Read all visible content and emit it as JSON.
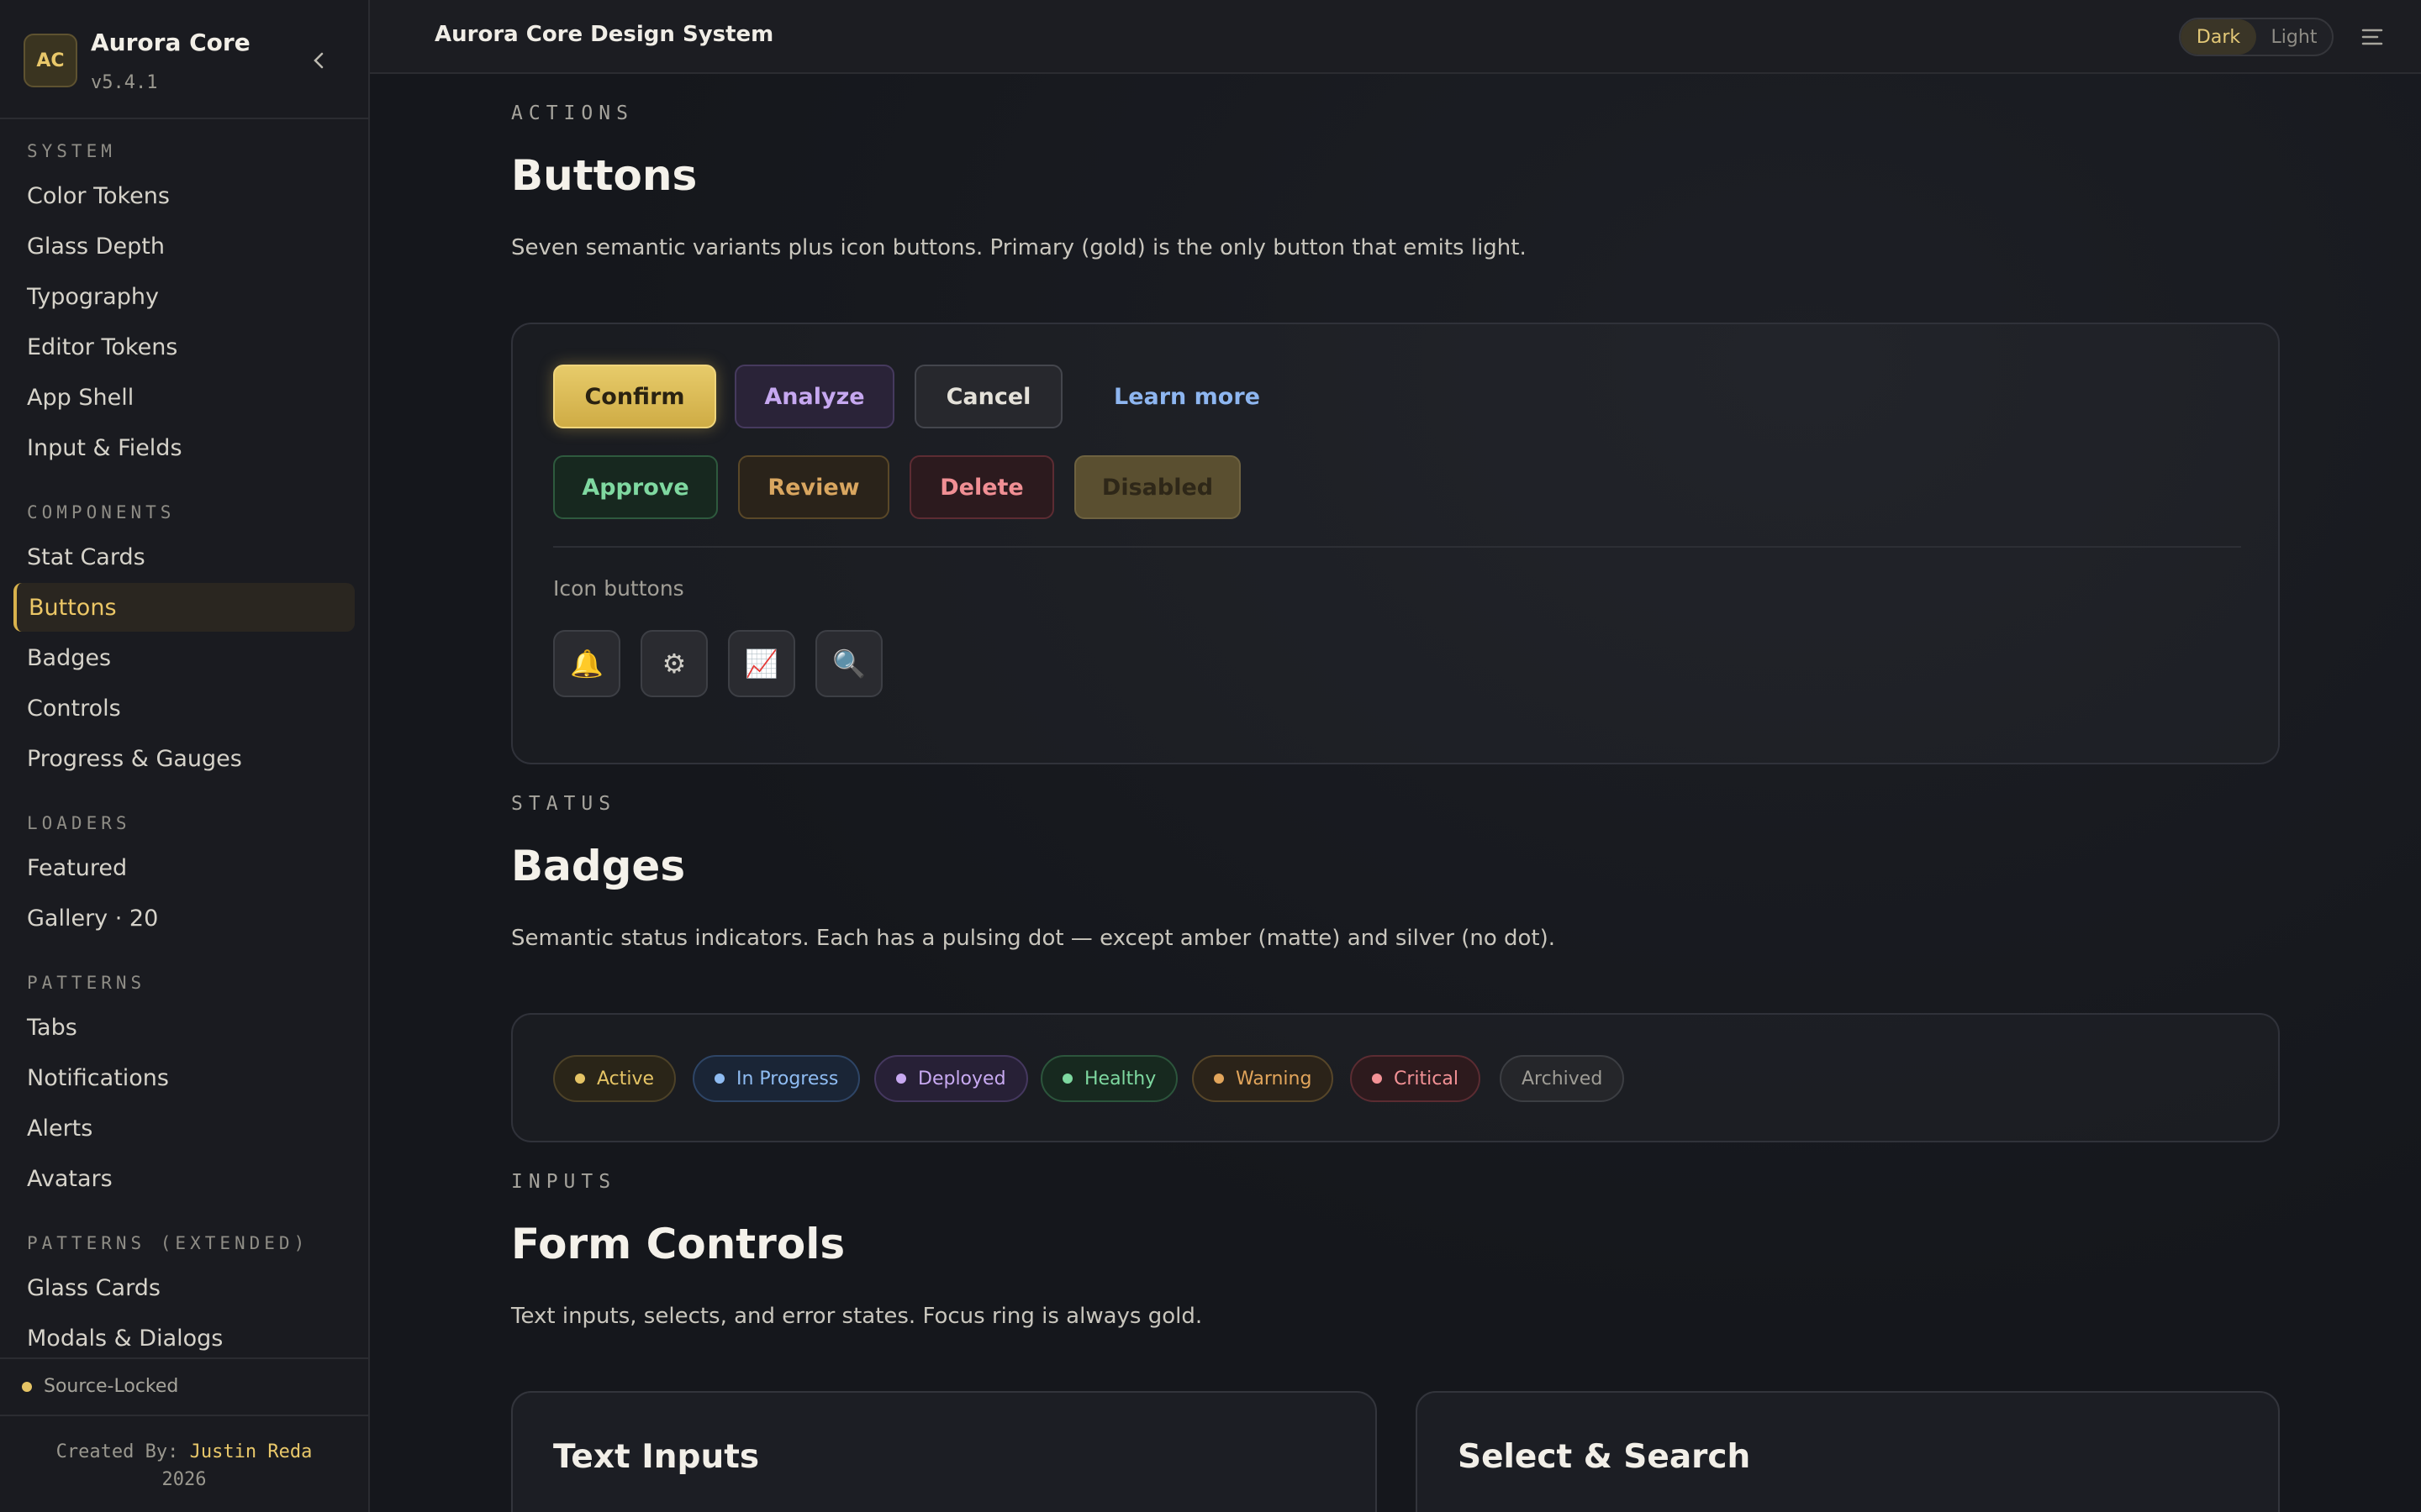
{
  "brand": {
    "logo": "AC",
    "name": "Aurora Core",
    "version": "v5.4.1"
  },
  "topbar": {
    "title": "Aurora Core Design System",
    "theme_dark": "Dark",
    "theme_light": "Light"
  },
  "sidebar": {
    "sections": [
      {
        "title": "SYSTEM",
        "items": [
          "Color Tokens",
          "Glass Depth",
          "Typography",
          "Editor Tokens",
          "App Shell",
          "Input & Fields"
        ]
      },
      {
        "title": "COMPONENTS",
        "items": [
          "Stat Cards",
          "Buttons",
          "Badges",
          "Controls",
          "Progress & Gauges"
        ]
      },
      {
        "title": "LOADERS",
        "items": [
          "Featured",
          "Gallery · 20"
        ]
      },
      {
        "title": "PATTERNS",
        "items": [
          "Tabs",
          "Notifications",
          "Alerts",
          "Avatars"
        ]
      },
      {
        "title": "PATTERNS (EXTENDED)",
        "items": [
          "Glass Cards",
          "Modals & Dialogs"
        ]
      }
    ],
    "active_item": "Buttons",
    "status": "Source-Locked",
    "credit_prefix": "Created By:",
    "credit_name": "Justin Reda",
    "credit_year": "2026"
  },
  "buttons_section": {
    "eyebrow": "ACTIONS",
    "title": "Buttons",
    "description": "Seven semantic variants plus icon buttons. Primary (gold) is the only button that emits light.",
    "row1": [
      "Confirm",
      "Analyze",
      "Cancel",
      "Learn more"
    ],
    "row2": [
      "Approve",
      "Review",
      "Delete",
      "Disabled"
    ],
    "icon_label": "Icon buttons",
    "icons": [
      "bell-icon",
      "gear-icon",
      "chart-icon",
      "search-icon"
    ]
  },
  "badges_section": {
    "eyebrow": "STATUS",
    "title": "Badges",
    "description": "Semantic status indicators. Each has a pulsing dot — except amber (matte) and silver (no dot).",
    "badges": [
      "Active",
      "In Progress",
      "Deployed",
      "Healthy",
      "Warning",
      "Critical",
      "Archived"
    ]
  },
  "inputs_section": {
    "eyebrow": "INPUTS",
    "title": "Form Controls",
    "description": "Text inputs, selects, and error states. Focus ring is always gold.",
    "card_left": "Text Inputs",
    "card_right": "Select & Search"
  },
  "colors": {
    "accent_gold": "#e9c86a",
    "background": "#15171c"
  }
}
